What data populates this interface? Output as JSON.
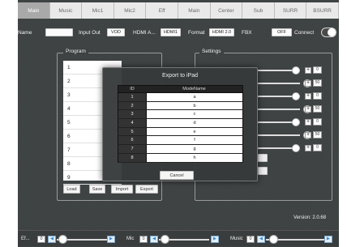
{
  "tabs": [
    "Main",
    "Music",
    "Mic1",
    "Mic2",
    "Eff",
    "Main",
    "Center",
    "Sub",
    "SURR",
    "BSURR"
  ],
  "header": {
    "name_label": "Name",
    "name_value": "",
    "input_out_label": "Input Out",
    "input_out_value": "VOD",
    "hdmi_a_label": "HDMI A...",
    "hdmi_a_value": "HDMI1",
    "format_label": "Format",
    "format_value": "HDMI 2.0",
    "fbx_label": "FBX",
    "fbx_value": "OFF",
    "connect_label": "Connect"
  },
  "program": {
    "title": "Program",
    "items": [
      "1",
      "2",
      "3",
      "4",
      "5",
      "6",
      "7",
      "8",
      "9"
    ],
    "buttons": [
      "Load",
      "Save",
      "Import",
      "Export"
    ]
  },
  "settings": {
    "title": "Settings",
    "rows": [
      {
        "value": "0"
      },
      {
        "value": "50"
      },
      {
        "value": "0"
      },
      {
        "value": "50"
      },
      {
        "value": "0"
      },
      {
        "value": "50"
      },
      {
        "value": "0"
      }
    ]
  },
  "modal": {
    "title": "Export to iPad",
    "col_id": "ID",
    "col_name": "ModeName",
    "rows": [
      {
        "id": "1",
        "name": "a"
      },
      {
        "id": "2",
        "name": "b"
      },
      {
        "id": "3",
        "name": "c"
      },
      {
        "id": "4",
        "name": "d"
      },
      {
        "id": "5",
        "name": "e"
      },
      {
        "id": "6",
        "name": "f"
      },
      {
        "id": "7",
        "name": "g"
      },
      {
        "id": "8",
        "name": "h"
      }
    ],
    "cancel_label": "Cancel"
  },
  "version": "Version: 2.0.68",
  "bottom": [
    {
      "label": "Ef...",
      "value": "0"
    },
    {
      "label": "Mic",
      "value": "0"
    },
    {
      "label": "Music",
      "value": "0"
    }
  ],
  "colors": {
    "bg": "#3c4141",
    "accent_blue": "#3b8ed6"
  }
}
